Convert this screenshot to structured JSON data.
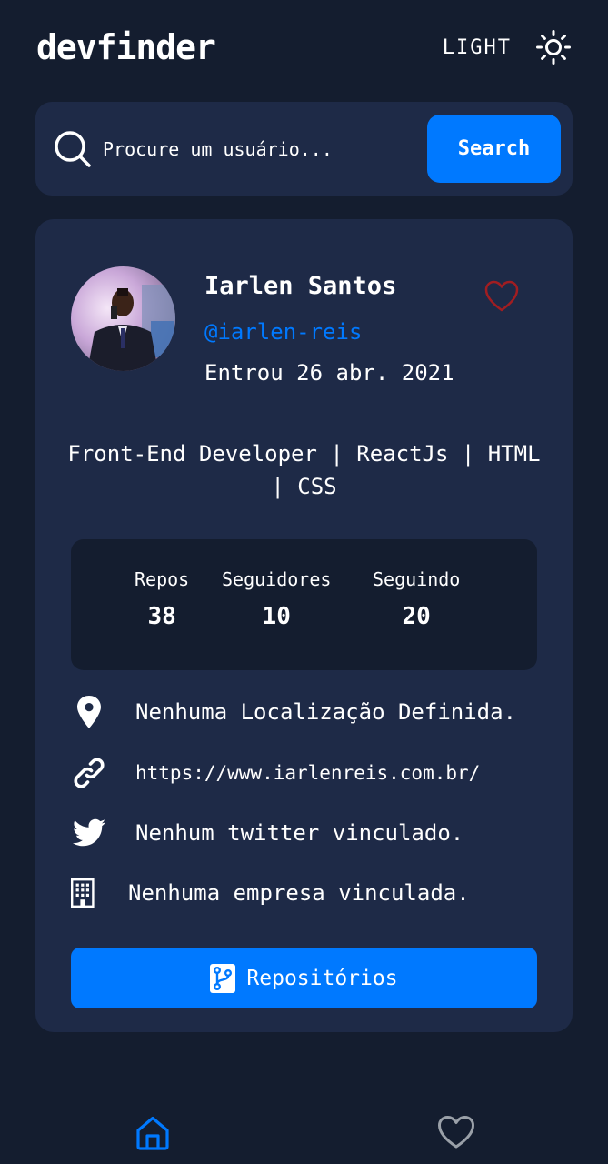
{
  "header": {
    "logo": "devfinder",
    "theme_label": "LIGHT",
    "theme_icon": "sun-icon"
  },
  "search": {
    "placeholder": "Procure um usuário...",
    "button_label": "Search",
    "icon": "search-icon"
  },
  "profile": {
    "name": "Iarlen Santos",
    "login": "@iarlen-reis",
    "joined": "Entrou 26 abr. 2021",
    "bio": "Front-End Developer | ReactJs | HTML | CSS",
    "favorite_icon": "heart-outline-icon",
    "stats": [
      {
        "label": "Repos",
        "value": "38"
      },
      {
        "label": "Seguidores",
        "value": "10"
      },
      {
        "label": "Seguindo",
        "value": "20"
      }
    ],
    "links": {
      "location": "Nenhuma Localização Definida.",
      "website": "https://www.iarlenreis.com.br/",
      "twitter": "Nenhum twitter vinculado.",
      "company": "Nenhuma empresa vinculada."
    },
    "repos_button": "Repositórios"
  },
  "colors": {
    "background": "#141d2f",
    "card": "#1e2a47",
    "accent": "#0079ff",
    "favorite": "#a11d21"
  },
  "nav": {
    "items": [
      {
        "icon": "home-icon",
        "active": true
      },
      {
        "icon": "heart-icon",
        "active": false
      }
    ]
  }
}
